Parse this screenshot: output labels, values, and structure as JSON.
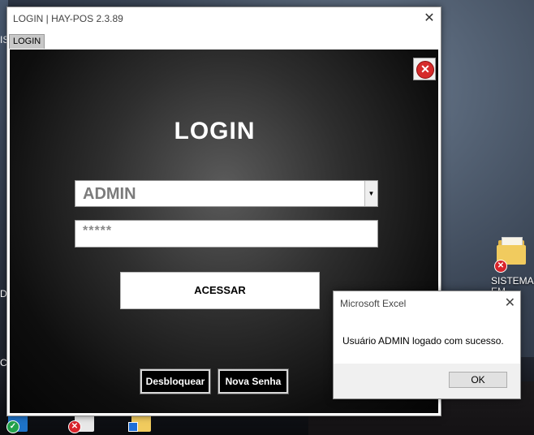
{
  "desktop": {
    "edge_letters": [
      "IS",
      "D",
      "C"
    ],
    "folder": {
      "label": "SISTEMAS EM VBA..."
    }
  },
  "window": {
    "title": "LOGIN | HAY-POS 2.3.89",
    "close_glyph": "✕",
    "tab_label": "LOGIN"
  },
  "login": {
    "heading": "LOGIN",
    "user_value": "ADMIN",
    "password_value": "*****",
    "submit_label": "ACESSAR",
    "unlock_label": "Desbloquear",
    "new_password_label": "Nova Senha",
    "close_icon_glyph": "✕"
  },
  "dialog": {
    "title": "Microsoft Excel",
    "close_glyph": "✕",
    "message": "Usuário ADMIN logado com sucesso.",
    "ok_label": "OK"
  },
  "colors": {
    "panel_bg": "#0e0e0e",
    "heading_text": "#ffffff",
    "close_red": "#d62b2b",
    "folder_yellow": "#f1cb5e"
  }
}
